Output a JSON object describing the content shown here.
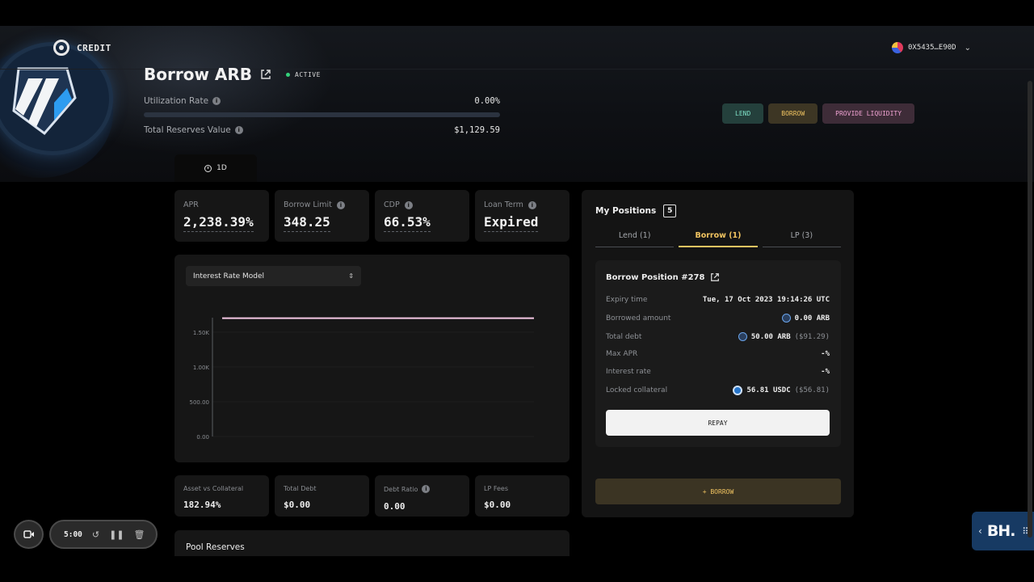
{
  "brand": {
    "name": "CREDIT"
  },
  "wallet": {
    "address": "0X5435…E90D"
  },
  "header": {
    "title": "Borrow ARB",
    "status": "ACTIVE",
    "utilization_label": "Utilization Rate",
    "utilization_value": "0.00%",
    "reserves_label": "Total Reserves Value",
    "reserves_value": "$1,129.59"
  },
  "actions": {
    "lend": "LEND",
    "borrow": "BORROW",
    "provide_liquidity": "PROVIDE LIQUIDITY"
  },
  "period_tab": {
    "label": "1D"
  },
  "stats": {
    "apr": {
      "label": "APR",
      "value": "2,238.39%"
    },
    "borrow_limit": {
      "label": "Borrow Limit",
      "value": "348.25"
    },
    "cdp": {
      "label": "CDP",
      "value": "66.53%"
    },
    "loan_term": {
      "label": "Loan Term",
      "value": "Expired"
    }
  },
  "chart": {
    "selector": "Interest Rate Model"
  },
  "chart_data": {
    "type": "line",
    "title": "",
    "xlabel": "",
    "ylabel": "",
    "y_ticks": [
      "0.00",
      "500.00",
      "1.00K",
      "1.50K"
    ],
    "ylim": [
      0,
      1800
    ],
    "series": [
      {
        "color": "#f4c8e4",
        "x": [
          0,
          1
        ],
        "y": [
          1700,
          1700
        ]
      }
    ]
  },
  "bottom_stats": {
    "asset_vs_collateral": {
      "label": "Asset vs Collateral",
      "value": "182.94%"
    },
    "total_debt": {
      "label": "Total Debt",
      "value": "$0.00"
    },
    "debt_ratio": {
      "label": "Debt Ratio",
      "value": "0.00"
    },
    "lp_fees": {
      "label": "LP Fees",
      "value": "$0.00"
    }
  },
  "positions": {
    "title": "My Positions",
    "count": "5",
    "tabs": [
      {
        "label": "Lend (1)"
      },
      {
        "label": "Borrow (1)"
      },
      {
        "label": "LP (3)"
      }
    ],
    "borrow_position": {
      "title": "Borrow Position #278",
      "rows": {
        "expiry": {
          "key": "Expiry time",
          "value": "Tue, 17 Oct 2023 19:14:26 UTC"
        },
        "borrowed": {
          "key": "Borrowed amount",
          "value": "0.00 ARB"
        },
        "total_debt": {
          "key": "Total debt",
          "value": "50.00 ARB",
          "sub": "($91.29)"
        },
        "max_apr": {
          "key": "Max APR",
          "value": "-%"
        },
        "interest": {
          "key": "Interest rate",
          "value": "-%"
        },
        "collateral": {
          "key": "Locked collateral",
          "value": "56.81 USDC",
          "sub": "($56.81)"
        }
      },
      "repay": "REPAY"
    },
    "borrow_button": "+ BORROW"
  },
  "pool_reserves": {
    "title": "Pool Reserves"
  },
  "recorder": {
    "time": "5:00"
  },
  "widget": {
    "text": "BH."
  },
  "colors": {
    "accent_yellow": "#f1c461",
    "accent_teal": "#7fe3c8",
    "accent_pink": "#f0a2d2",
    "status_green": "#33d17a"
  }
}
